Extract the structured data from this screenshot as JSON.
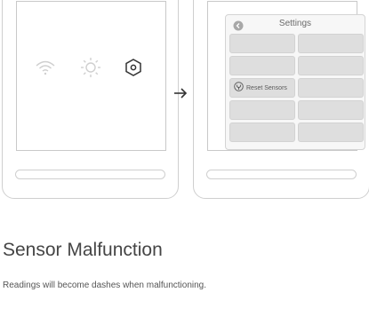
{
  "home_screen": {
    "icons": [
      "wifi-icon",
      "sun-icon",
      "hex-gear-icon"
    ]
  },
  "transition": {
    "icon": "right-arrow-icon"
  },
  "settings_screen": {
    "title": "Settings",
    "back_icon": "back-chevron-icon",
    "active_item": {
      "label": "Reset Sensors",
      "icon": "reset-sensor-icon"
    },
    "grid_rows": 5,
    "grid_cols": 2
  },
  "section": {
    "title": "Sensor Malfunction",
    "description": "Readings will become dashes when malfunctioning."
  },
  "colors": {
    "outline": "#cfcfcf",
    "tile": "#dedede",
    "text": "#4a4a4a"
  }
}
